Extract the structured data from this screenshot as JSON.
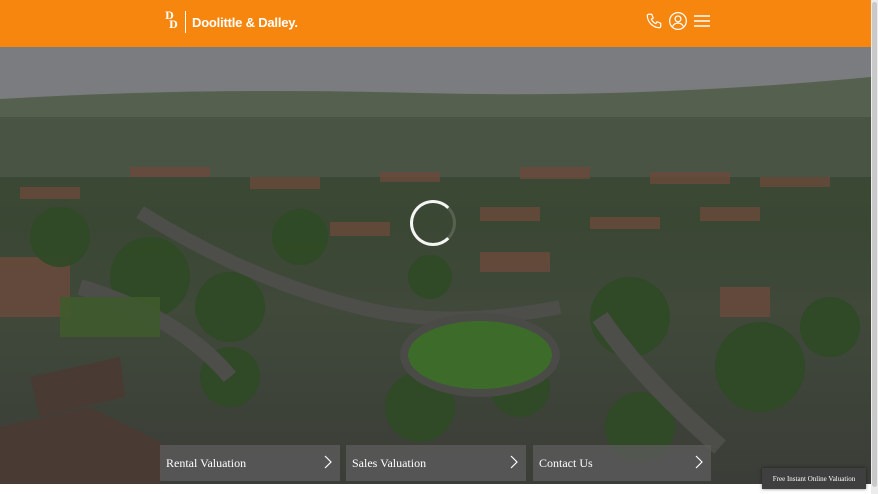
{
  "header": {
    "brand": "Doolittle & Dalley.",
    "logo_letters": [
      "D",
      "D"
    ],
    "bg_color": "#f7860f",
    "icons": [
      "phone-icon",
      "user-account-icon",
      "hamburger-menu-icon"
    ]
  },
  "hero": {
    "loading_indicator": "spinner-icon"
  },
  "cta_buttons": [
    {
      "label": "Rental Valuation"
    },
    {
      "label": "Sales Valuation"
    },
    {
      "label": "Contact Us"
    }
  ],
  "floating_button": {
    "label": "Free Instant Online Valuation"
  }
}
